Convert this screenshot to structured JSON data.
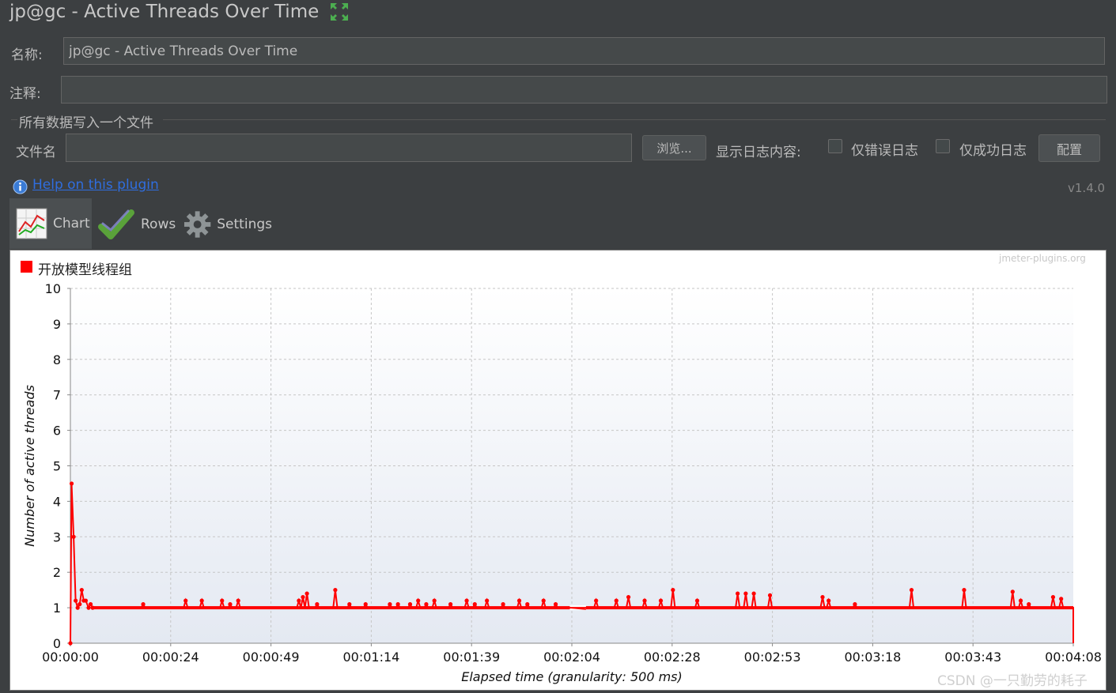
{
  "window": {
    "title": "jp@gc - Active Threads Over Time"
  },
  "form": {
    "name_label": "名称:",
    "name_value": "jp@gc - Active Threads Over Time",
    "comment_label": "注释:",
    "comment_value": "",
    "section_title": "所有数据写入一个文件",
    "filename_label": "文件名",
    "filename_value": "",
    "browse_label": "浏览...",
    "log_display_label": "显示日志内容:",
    "errors_only_label": "仅错误日志",
    "success_only_label": "仅成功日志",
    "configure_label": "配置"
  },
  "help": {
    "link_text": "Help on this plugin",
    "version": "v1.4.0"
  },
  "tabs": [
    {
      "label": "Chart",
      "icon": "chart-icon",
      "active": true
    },
    {
      "label": "Rows",
      "icon": "checkmark-icon",
      "active": false
    },
    {
      "label": "Settings",
      "icon": "gear-icon",
      "active": false
    }
  ],
  "chart_data": {
    "type": "line",
    "watermark": "jmeter-plugins.org",
    "legend_position": "top-left",
    "grid": true,
    "xlabel": "Elapsed time (granularity: 500 ms)",
    "ylabel": "Number of active threads",
    "xlim_seconds": [
      0,
      248
    ],
    "ylim": [
      0,
      10
    ],
    "x_tick_labels": [
      "00:00:00",
      "00:00:24",
      "00:00:49",
      "00:01:14",
      "00:01:39",
      "00:02:04",
      "00:02:28",
      "00:02:53",
      "00:03:18",
      "00:03:43",
      "00:04:08"
    ],
    "y_tick_labels": [
      "0",
      "1",
      "2",
      "3",
      "4",
      "5",
      "6",
      "7",
      "8",
      "9",
      "10"
    ],
    "series": [
      {
        "name": "开放模型线程组",
        "color": "#ff0000",
        "baseline": 1,
        "start": [
          [
            0,
            0
          ],
          [
            0.3,
            4.5
          ],
          [
            0.8,
            3
          ],
          [
            1.3,
            1.2
          ],
          [
            1.8,
            1
          ],
          [
            2.3,
            1.1
          ],
          [
            2.8,
            1.5
          ],
          [
            3.3,
            1.2
          ],
          [
            3.8,
            1.2
          ],
          [
            4.5,
            1
          ],
          [
            5,
            1.1
          ],
          [
            5.5,
            1
          ]
        ],
        "end": [
          [
            248,
            1
          ],
          [
            248,
            0
          ]
        ],
        "gap": [
          123.5,
          127.5
        ],
        "spikes": [
          [
            18,
            1.1
          ],
          [
            28.5,
            1.2
          ],
          [
            32.5,
            1.2
          ],
          [
            37.5,
            1.2
          ],
          [
            39.5,
            1.1
          ],
          [
            41.5,
            1.2
          ],
          [
            56.5,
            1.2
          ],
          [
            57.5,
            1.3
          ],
          [
            58.5,
            1.4
          ],
          [
            61,
            1.1
          ],
          [
            65.5,
            1.5
          ],
          [
            69,
            1.1
          ],
          [
            73,
            1.1
          ],
          [
            79,
            1.1
          ],
          [
            81,
            1.1
          ],
          [
            84,
            1.1
          ],
          [
            86,
            1.2
          ],
          [
            88,
            1.1
          ],
          [
            90,
            1.2
          ],
          [
            94,
            1.1
          ],
          [
            98,
            1.2
          ],
          [
            100,
            1.1
          ],
          [
            103,
            1.2
          ],
          [
            107,
            1.1
          ],
          [
            111,
            1.2
          ],
          [
            113,
            1.1
          ],
          [
            117,
            1.2
          ],
          [
            120,
            1.1
          ],
          [
            130,
            1.2
          ],
          [
            135,
            1.2
          ],
          [
            138,
            1.3
          ],
          [
            142,
            1.2
          ],
          [
            146,
            1.2
          ],
          [
            149,
            1.5
          ],
          [
            155,
            1.2
          ],
          [
            165,
            1.4
          ],
          [
            167,
            1.4
          ],
          [
            169,
            1.4
          ],
          [
            173,
            1.35
          ],
          [
            186,
            1.3
          ],
          [
            187.5,
            1.2
          ],
          [
            194,
            1.1
          ],
          [
            208,
            1.5
          ],
          [
            221,
            1.5
          ],
          [
            233,
            1.45
          ],
          [
            235,
            1.2
          ],
          [
            237,
            1.1
          ],
          [
            243,
            1.3
          ],
          [
            245,
            1.25
          ]
        ]
      }
    ]
  },
  "footer": {
    "credit": "CSDN @一只勤劳的耗子"
  }
}
